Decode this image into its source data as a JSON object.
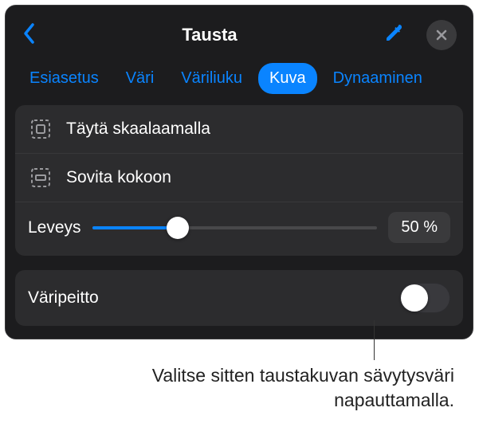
{
  "accent": "#0a84ff",
  "header": {
    "title": "Tausta"
  },
  "tabs": {
    "preset": "Esiasetus",
    "color": "Väri",
    "gradient": "Väriliuku",
    "image": "Kuva",
    "dynamic": "Dynaaminen"
  },
  "scale_options": {
    "fill": "Täytä skaalaamalla",
    "fit": "Sovita kokoon"
  },
  "slider": {
    "label": "Leveys",
    "value_text": "50 %",
    "percent": 30
  },
  "overlay": {
    "label": "Väripeitto",
    "on": false
  },
  "callout": {
    "text": "Valitse sitten taustakuvan sävytysväri napauttamalla."
  }
}
